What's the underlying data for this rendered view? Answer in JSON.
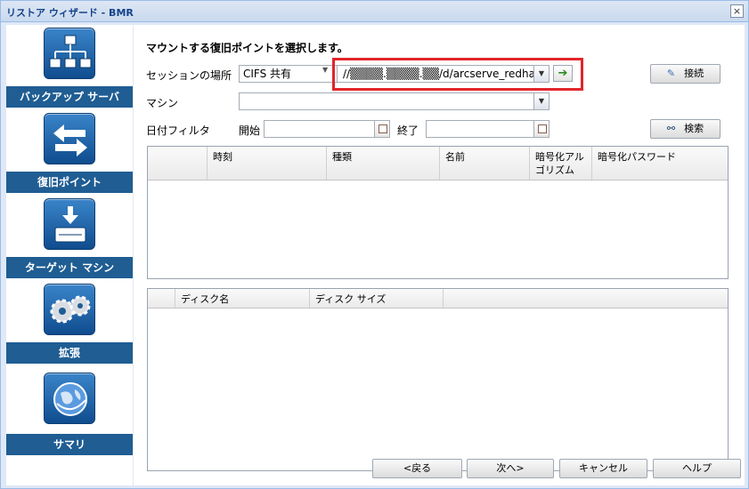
{
  "window": {
    "title": "リストア ウィザード - BMR",
    "close_label": "×"
  },
  "sidebar": {
    "items": [
      {
        "label": "バックアップ サーバ",
        "icon": "server-network-icon"
      },
      {
        "label": "復旧ポイント",
        "icon": "exchange-arrows-icon"
      },
      {
        "label": "ターゲット マシン",
        "icon": "download-drive-icon"
      },
      {
        "label": "拡張",
        "icon": "gears-icon"
      },
      {
        "label": "サマリ",
        "icon": "globe-icon"
      }
    ]
  },
  "main": {
    "heading": "マウントする復旧ポイントを選択します。",
    "session_location_label": "セッションの場所",
    "session_type_value": "CIFS 共有",
    "session_path_value": "//▒▒▒▒.▒▒▒▒.▒▒/d/arcserve_redhat_backup",
    "connect_button": "接続",
    "machine_label": "マシン",
    "machine_value": "",
    "date_filter_label": "日付フィルタ",
    "start_label": "開始",
    "end_label": "終了",
    "search_button": "検索"
  },
  "recovery_points_table": {
    "columns": [
      "",
      "時刻",
      "種類",
      "名前",
      "暗号化アル\nゴリズム",
      "暗号化パスワード"
    ],
    "rows": []
  },
  "disk_table": {
    "columns": [
      "",
      "ディスク名",
      "ディスク サイズ",
      ""
    ],
    "rows": []
  },
  "footer": {
    "back_button": "<戻る",
    "next_button": "次へ>",
    "cancel_button": "キャンセル",
    "help_button": "ヘルプ"
  },
  "colors": {
    "accent": "#1f5d93",
    "highlight": "#e2252b",
    "go_arrow": "#2a8a23"
  }
}
